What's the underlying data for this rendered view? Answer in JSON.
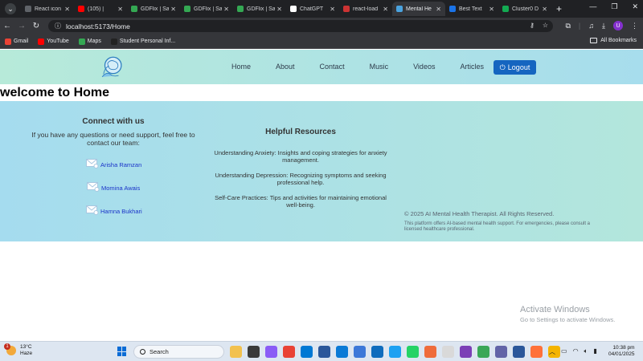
{
  "browser": {
    "tabs": [
      {
        "title": "React icon",
        "color": "#5f6368"
      },
      {
        "title": "(105) |",
        "color": "#ff0000"
      },
      {
        "title": "GDFlix | Sa",
        "color": "#34a853"
      },
      {
        "title": "GDFlix | Sa",
        "color": "#34a853"
      },
      {
        "title": "GDFlix | Sa",
        "color": "#34a853"
      },
      {
        "title": "ChatGPT",
        "color": "#ffffff"
      },
      {
        "title": "react-load",
        "color": "#cc3333"
      },
      {
        "title": "Mental He",
        "color": "#4aa3df",
        "active": true
      },
      {
        "title": "Best Text",
        "color": "#1a73e8"
      },
      {
        "title": "Cluster0 D",
        "color": "#13aa52"
      }
    ],
    "new_tab": "+",
    "url": "localhost:5173/Home",
    "profile_initial": "U",
    "bookmarks": [
      {
        "label": "Gmail",
        "color": "#ea4335"
      },
      {
        "label": "YouTube",
        "color": "#ff0000"
      },
      {
        "label": "Maps",
        "color": "#34a853"
      },
      {
        "label": "Student Personal Inf...",
        "color": "#222222"
      }
    ],
    "all_bookmarks": "All Bookmarks"
  },
  "page": {
    "nav_links": [
      "Home",
      "About",
      "Contact",
      "Music",
      "Videos",
      "Articles"
    ],
    "logout_label": "Logout",
    "welcome": "welcome to Home",
    "connect": {
      "title": "Connect with us",
      "text": "If you have any questions or need support, feel free to contact our team:",
      "contacts": [
        "Arisha Ramzan",
        "Momina Awais",
        "Hamna Bukhari"
      ]
    },
    "resources": {
      "title": "Helpful Resources",
      "items": [
        "Understanding Anxiety: Insights and coping strategies for anxiety management.",
        "Understanding Depression: Recognizing symptoms and seeking professional help.",
        "Self-Care Practices: Tips and activities for maintaining emotional well-being."
      ]
    },
    "copyright": "© 2025 AI Mental Health Therapist. All Rights Reserved.",
    "disclaimer": "This platform offers AI-based mental health support. For emergencies, please consult a licensed healthcare professional.",
    "activate_title": "Activate Windows",
    "activate_sub": "Go to Settings to activate Windows."
  },
  "taskbar": {
    "temperature": "13°C",
    "condition": "Haze",
    "notification_count": "1",
    "search_label": "Search",
    "time": "10:38 pm",
    "date": "04/01/2025",
    "app_colors": [
      "#f2c14e",
      "#3a3a3a",
      "#8a5cf6",
      "#e94235",
      "#0078d4",
      "#2b579a",
      "#0a7ad6",
      "#3c78d8",
      "#0f6cbd",
      "#1da1f2",
      "#25d366",
      "#ef6c3b",
      "#d9d9d9",
      "#7b3fb6",
      "#3aa757",
      "#6264a7",
      "#2b579a",
      "#ff7139",
      "#f4b400"
    ]
  }
}
